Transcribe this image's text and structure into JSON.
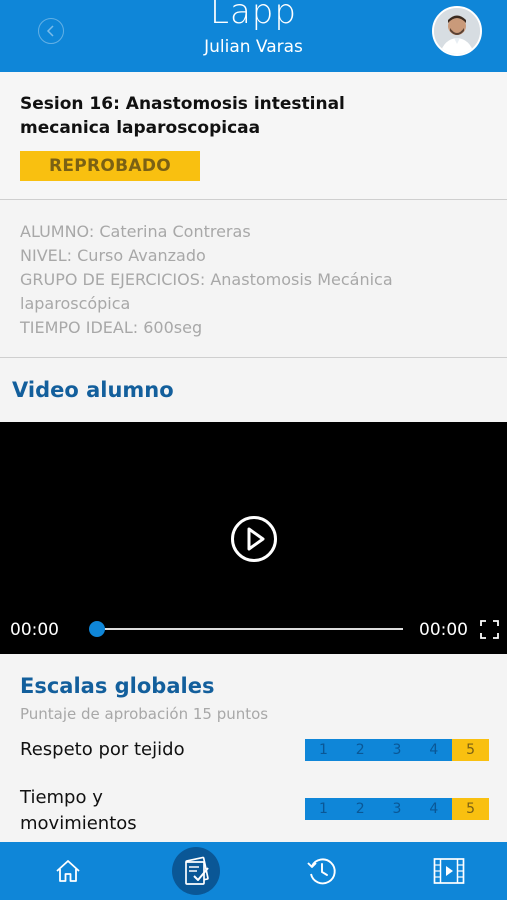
{
  "header": {
    "app_name": "Lapp",
    "user_name": "Julian Varas"
  },
  "session": {
    "title": "Sesion 16: Anastomosis intestinal mecanica laparoscopicaa",
    "status": "REPROBADO"
  },
  "details": {
    "alumno": "ALUMNO: Caterina Contreras",
    "nivel": "NIVEL: Curso Avanzado",
    "grupo_line1": "GRUPO DE EJERCICIOS: Anastomosis Mecánica",
    "grupo_line2": "laparoscópica",
    "tiempo": "TIEMPO IDEAL: 600seg"
  },
  "video": {
    "section_title": "Video alumno",
    "time_current": "00:00",
    "time_total": "00:00",
    "progress": 0
  },
  "scales": {
    "title": "Escalas globales",
    "subtitle": "Puntaje de aprobación 15 puntos",
    "criteria": [
      {
        "label_line1": "Respeto por tejido",
        "label_line2": "",
        "values": [
          "1",
          "2",
          "3",
          "4",
          "5"
        ],
        "selected": 5
      },
      {
        "label_line1": "Tiempo y",
        "label_line2": "movimientos",
        "values": [
          "1",
          "2",
          "3",
          "4",
          "5"
        ],
        "selected": 5
      }
    ]
  },
  "tabbar": {
    "active": "evaluations",
    "icons": [
      "home-icon",
      "evaluations-icon",
      "history-icon",
      "video-icon"
    ]
  },
  "colors": {
    "primary": "#0f86d8",
    "dark_blue": "#135f9c",
    "warning": "#f9c010"
  }
}
